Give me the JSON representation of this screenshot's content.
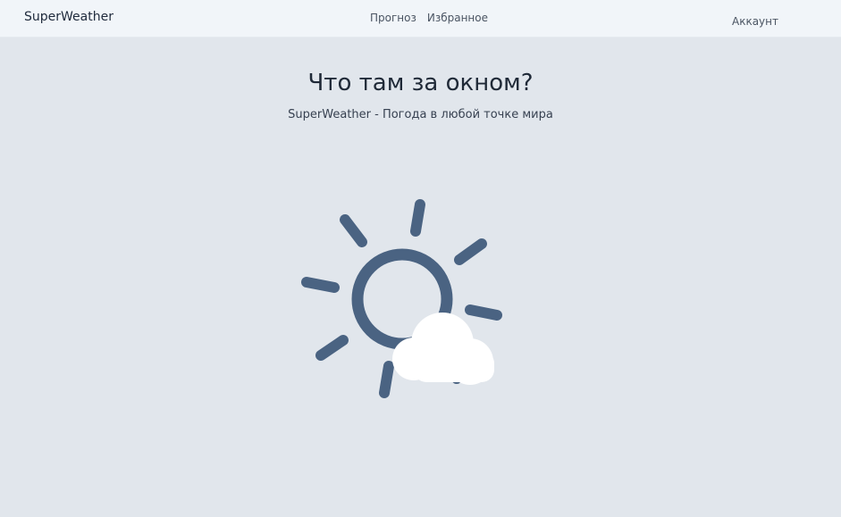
{
  "app": {
    "brand": "SuperWeather"
  },
  "nav": {
    "items": [
      {
        "label": "Прогноз"
      },
      {
        "label": "Избранное"
      }
    ],
    "account_label": "Аккаунт"
  },
  "hero": {
    "title": "Что там за окном?",
    "subtitle": "SuperWeather - Погода в любой точке мира"
  },
  "illustration": {
    "icon": "sun-behind-cloud-icon",
    "sun_color": "#4a6382",
    "cloud_color": "#ffffff"
  },
  "colors": {
    "background": "#e1e6ec",
    "navbar": "#f1f5f9"
  }
}
